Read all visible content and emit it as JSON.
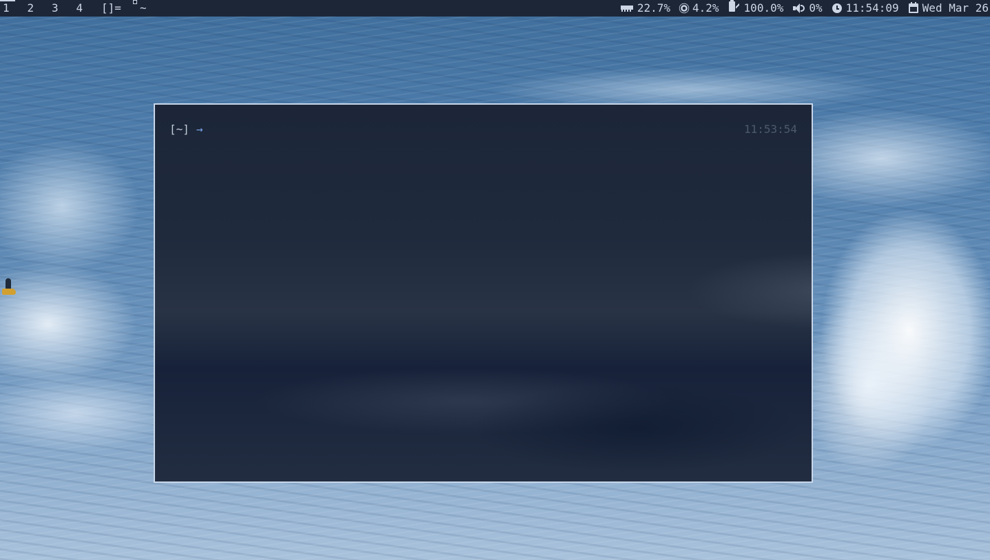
{
  "topbar": {
    "tags": [
      "1",
      "2",
      "3",
      "4"
    ],
    "active_tag": "1",
    "layout_symbol": "[]=",
    "window_title": "~",
    "status": {
      "ram": "22.7%",
      "cpu": "4.2%",
      "battery": "100.0%",
      "volume": "0%",
      "time": "11:54:09",
      "date": "Wed Mar 26"
    }
  },
  "terminal": {
    "prompt_dir": "[~]",
    "prompt_arrow": "→",
    "right_prompt_time": "11:53:54"
  },
  "colors": {
    "bar_bg": "#1d2637",
    "bar_fg": "#cdd6e4",
    "terminal_border": "#c8d7ea",
    "prompt_arrow": "#7aa2e8",
    "rprompt": "#4d5a6d"
  }
}
